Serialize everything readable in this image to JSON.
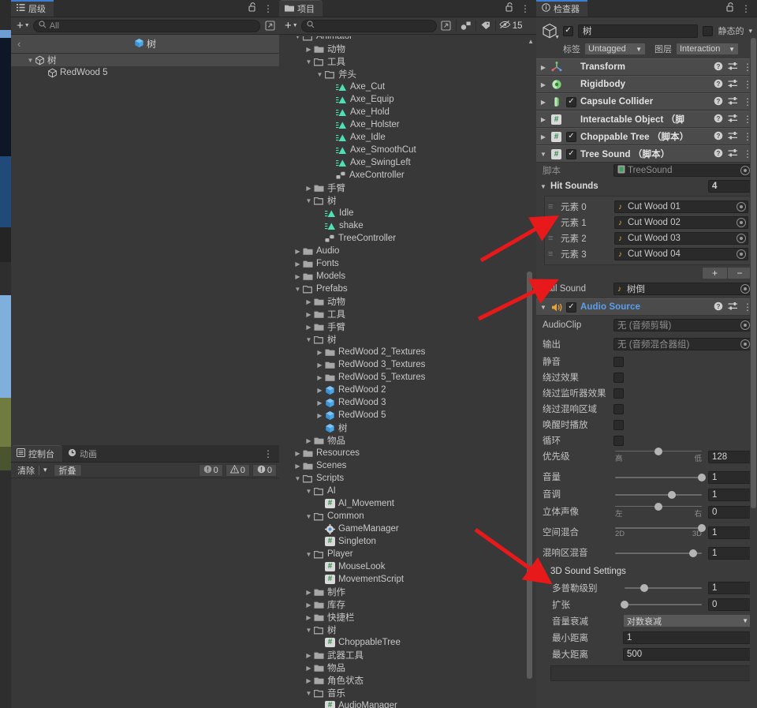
{
  "hierarchy": {
    "tab_label": "层级",
    "tab_icon": "hierarchy-icon",
    "lock_icon": "lock-open-icon",
    "menu_icon": "kebab-menu-icon",
    "add_label": "+",
    "search_placeholder": "All",
    "search_value": "",
    "breadcrumb_back": "‹",
    "breadcrumb_label": "树",
    "rows": [
      {
        "label": "树",
        "depth": 1,
        "twist": "▼",
        "selected": true,
        "icon": "gameobject-icon"
      },
      {
        "label": "RedWood 5",
        "depth": 2,
        "twist": "",
        "selected": false,
        "icon": "gameobject-icon"
      }
    ]
  },
  "project": {
    "tab_label": "项目",
    "lock_icon": "lock-open-icon",
    "menu_icon": "kebab-menu-icon",
    "add_label": "+",
    "search_placeholder": "",
    "search_value": "",
    "toolbar_icons": [
      "save-search-icon",
      "search-by-type-icon",
      "search-by-label-icon"
    ],
    "hidden_count": "15",
    "rows": [
      {
        "label": "Animator",
        "depth": 1,
        "twist": "▼",
        "icon": "folder-open",
        "cut": true
      },
      {
        "label": "动物",
        "depth": 2,
        "twist": "▶",
        "icon": "folder"
      },
      {
        "label": "工具",
        "depth": 2,
        "twist": "▼",
        "icon": "folder-open"
      },
      {
        "label": "斧头",
        "depth": 3,
        "twist": "▼",
        "icon": "folder-open"
      },
      {
        "label": "Axe_Cut",
        "depth": 4,
        "twist": "",
        "icon": "animation-clip"
      },
      {
        "label": "Axe_Equip",
        "depth": 4,
        "twist": "",
        "icon": "animation-clip"
      },
      {
        "label": "Axe_Hold",
        "depth": 4,
        "twist": "",
        "icon": "animation-clip"
      },
      {
        "label": "Axe_Holster",
        "depth": 4,
        "twist": "",
        "icon": "animation-clip"
      },
      {
        "label": "Axe_Idle",
        "depth": 4,
        "twist": "",
        "icon": "animation-clip"
      },
      {
        "label": "Axe_SmoothCut",
        "depth": 4,
        "twist": "",
        "icon": "animation-clip"
      },
      {
        "label": "Axe_SwingLeft",
        "depth": 4,
        "twist": "",
        "icon": "animation-clip"
      },
      {
        "label": "AxeController",
        "depth": 4,
        "twist": "",
        "icon": "animator-controller"
      },
      {
        "label": "手臂",
        "depth": 2,
        "twist": "▶",
        "icon": "folder"
      },
      {
        "label": "树",
        "depth": 2,
        "twist": "▼",
        "icon": "folder-open"
      },
      {
        "label": "Idle",
        "depth": 3,
        "twist": "",
        "icon": "animation-clip"
      },
      {
        "label": "shake",
        "depth": 3,
        "twist": "",
        "icon": "animation-clip"
      },
      {
        "label": "TreeController",
        "depth": 3,
        "twist": "",
        "icon": "animator-controller"
      },
      {
        "label": "Audio",
        "depth": 1,
        "twist": "▶",
        "icon": "folder"
      },
      {
        "label": "Fonts",
        "depth": 1,
        "twist": "▶",
        "icon": "folder"
      },
      {
        "label": "Models",
        "depth": 1,
        "twist": "▶",
        "icon": "folder"
      },
      {
        "label": "Prefabs",
        "depth": 1,
        "twist": "▼",
        "icon": "folder-open"
      },
      {
        "label": "动物",
        "depth": 2,
        "twist": "▶",
        "icon": "folder"
      },
      {
        "label": "工具",
        "depth": 2,
        "twist": "▶",
        "icon": "folder"
      },
      {
        "label": "手臂",
        "depth": 2,
        "twist": "▶",
        "icon": "folder"
      },
      {
        "label": "树",
        "depth": 2,
        "twist": "▼",
        "icon": "folder-open"
      },
      {
        "label": "RedWood 2_Textures",
        "depth": 3,
        "twist": "▶",
        "icon": "folder"
      },
      {
        "label": "RedWood 3_Textures",
        "depth": 3,
        "twist": "▶",
        "icon": "folder"
      },
      {
        "label": "RedWood 5_Textures",
        "depth": 3,
        "twist": "▶",
        "icon": "folder"
      },
      {
        "label": "RedWood 2",
        "depth": 3,
        "twist": "▶",
        "icon": "prefab"
      },
      {
        "label": "RedWood 3",
        "depth": 3,
        "twist": "▶",
        "icon": "prefab"
      },
      {
        "label": "RedWood 5",
        "depth": 3,
        "twist": "▶",
        "icon": "prefab"
      },
      {
        "label": "树",
        "depth": 3,
        "twist": "",
        "icon": "prefab"
      },
      {
        "label": "物品",
        "depth": 2,
        "twist": "▶",
        "icon": "folder"
      },
      {
        "label": "Resources",
        "depth": 1,
        "twist": "▶",
        "icon": "folder"
      },
      {
        "label": "Scenes",
        "depth": 1,
        "twist": "▶",
        "icon": "folder"
      },
      {
        "label": "Scripts",
        "depth": 1,
        "twist": "▼",
        "icon": "folder-open"
      },
      {
        "label": "AI",
        "depth": 2,
        "twist": "▼",
        "icon": "folder-open"
      },
      {
        "label": "AI_Movement",
        "depth": 3,
        "twist": "",
        "icon": "csharp-script"
      },
      {
        "label": "Common",
        "depth": 2,
        "twist": "▼",
        "icon": "folder-open"
      },
      {
        "label": "GameManager",
        "depth": 3,
        "twist": "",
        "icon": "gear-script"
      },
      {
        "label": "Singleton",
        "depth": 3,
        "twist": "",
        "icon": "csharp-script"
      },
      {
        "label": "Player",
        "depth": 2,
        "twist": "▼",
        "icon": "folder-open"
      },
      {
        "label": "MouseLook",
        "depth": 3,
        "twist": "",
        "icon": "csharp-script"
      },
      {
        "label": "MovementScript",
        "depth": 3,
        "twist": "",
        "icon": "csharp-script"
      },
      {
        "label": "制作",
        "depth": 2,
        "twist": "▶",
        "icon": "folder"
      },
      {
        "label": "库存",
        "depth": 2,
        "twist": "▶",
        "icon": "folder"
      },
      {
        "label": "快捷栏",
        "depth": 2,
        "twist": "▶",
        "icon": "folder"
      },
      {
        "label": "树",
        "depth": 2,
        "twist": "▼",
        "icon": "folder-open"
      },
      {
        "label": "ChoppableTree",
        "depth": 3,
        "twist": "",
        "icon": "csharp-script"
      },
      {
        "label": "武器工具",
        "depth": 2,
        "twist": "▶",
        "icon": "folder"
      },
      {
        "label": "物品",
        "depth": 2,
        "twist": "▶",
        "icon": "folder"
      },
      {
        "label": "角色状态",
        "depth": 2,
        "twist": "▶",
        "icon": "folder"
      },
      {
        "label": "音乐",
        "depth": 2,
        "twist": "▼",
        "icon": "folder-open"
      },
      {
        "label": "AudioManager",
        "depth": 3,
        "twist": "",
        "icon": "csharp-script"
      }
    ]
  },
  "console": {
    "tabs": [
      {
        "label": "控制台",
        "icon": "console-icon",
        "active": true
      },
      {
        "label": "动画",
        "icon": "clock-icon",
        "active": false
      }
    ],
    "menu_icon": "kebab-menu-icon",
    "clear_label": "清除",
    "clear_dropdown": "▾",
    "collapse_label": "折叠",
    "counts": {
      "error": "0",
      "warning": "0",
      "info": "0"
    }
  },
  "inspector": {
    "tab_label": "检查器",
    "tab_icon": "info-icon",
    "lock_icon": "lock-open-icon",
    "menu_icon": "kebab-menu-icon",
    "gameobject": {
      "icon": "gameobject-cube-icon",
      "enabled": true,
      "name": "树",
      "static_label": "静态的",
      "static_checked": false,
      "static_dropdown": "▾",
      "tag_label": "标签",
      "tag_value": "Untagged",
      "layer_label": "图层",
      "layer_value": "Interaction"
    },
    "components": [
      {
        "name": "Transform",
        "icon": "transform-icon",
        "has_checkbox": false,
        "expanded": false,
        "suffix": ""
      },
      {
        "name": "Rigidbody",
        "icon": "rigidbody-icon",
        "has_checkbox": false,
        "expanded": false,
        "suffix": ""
      },
      {
        "name": "Capsule Collider",
        "icon": "collider-icon",
        "has_checkbox": true,
        "checked": true,
        "expanded": false,
        "suffix": ""
      },
      {
        "name": "Interactable Object",
        "icon": "script-icon",
        "has_checkbox": false,
        "expanded": false,
        "suffix": "（脚"
      },
      {
        "name": "Choppable Tree",
        "icon": "script-icon",
        "has_checkbox": true,
        "checked": true,
        "expanded": false,
        "suffix": "（脚本）"
      },
      {
        "name": "Tree Sound",
        "icon": "script-icon",
        "has_checkbox": true,
        "checked": true,
        "expanded": true,
        "suffix": "（脚本）"
      }
    ],
    "tree_sound": {
      "script_label": "脚本",
      "script_value": "TreeSound",
      "hit_sounds": {
        "label": "Hit Sounds",
        "size": "4",
        "elements": [
          {
            "label": "元素 0",
            "value": "Cut Wood 01"
          },
          {
            "label": "元素 1",
            "value": "Cut Wood 02"
          },
          {
            "label": "元素 2",
            "value": "Cut Wood 03"
          },
          {
            "label": "元素 3",
            "value": "Cut Wood 04"
          }
        ],
        "add_label": "+",
        "remove_label": "−"
      },
      "fall_sound": {
        "label": "Fall Sound",
        "value": "树倒"
      }
    },
    "audio_source": {
      "title": "Audio Source",
      "icon": "speaker-icon",
      "enabled": true,
      "audio_clip": {
        "label": "AudioClip",
        "value": "无 (音频剪辑)"
      },
      "output": {
        "label": "输出",
        "value": "无 (音频混合器组)"
      },
      "toggles": [
        {
          "label": "静音",
          "checked": false
        },
        {
          "label": "绕过效果",
          "checked": false
        },
        {
          "label": "绕过监听器效果",
          "checked": false
        },
        {
          "label": "绕过混响区域",
          "checked": false
        },
        {
          "label": "唤醒时播放",
          "checked": false
        },
        {
          "label": "循环",
          "checked": false
        }
      ],
      "sliders": [
        {
          "label": "优先级",
          "value": "128",
          "pos": 50,
          "min_label": "高",
          "max_label": "低"
        },
        {
          "label": "音量",
          "value": "1",
          "pos": 100,
          "min_label": "",
          "max_label": ""
        },
        {
          "label": "音调",
          "value": "1",
          "pos": 65,
          "min_label": "",
          "max_label": ""
        },
        {
          "label": "立体声像",
          "value": "0",
          "pos": 50,
          "min_label": "左",
          "max_label": "右"
        },
        {
          "label": "空间混合",
          "value": "1",
          "pos": 100,
          "min_label": "2D",
          "max_label": "3D"
        },
        {
          "label": "混响区混音",
          "value": "1",
          "pos": 90,
          "min_label": "",
          "max_label": ""
        }
      ],
      "sound3d": {
        "title": "3D Sound Settings",
        "doppler": {
          "label": "多普勒级别",
          "value": "1",
          "pos": 25
        },
        "spread": {
          "label": "扩张",
          "value": "0",
          "pos": 0
        },
        "rolloff": {
          "label": "音量衰减",
          "value": "对数衰减"
        },
        "min_distance": {
          "label": "最小距离",
          "value": "1"
        },
        "max_distance": {
          "label": "最大距离",
          "value": "500"
        }
      }
    }
  },
  "annotations": {
    "arrow_color": "#e8191b",
    "arrows": [
      {
        "name": "arrow-to-hit-sounds"
      },
      {
        "name": "arrow-to-fall-sound"
      },
      {
        "name": "arrow-to-spatial-blend"
      }
    ]
  },
  "colors": {
    "accent_blue": "#3c7fd0",
    "component_header": "#4b4b4b",
    "panel_bg": "#383838",
    "inspector_bg": "#3b3b3b",
    "audio_title": "#5a9ff0",
    "note_yellow": "#e8b33a",
    "anim_green": "#4ee0b4",
    "prefab_blue": "#4aa6e8"
  }
}
